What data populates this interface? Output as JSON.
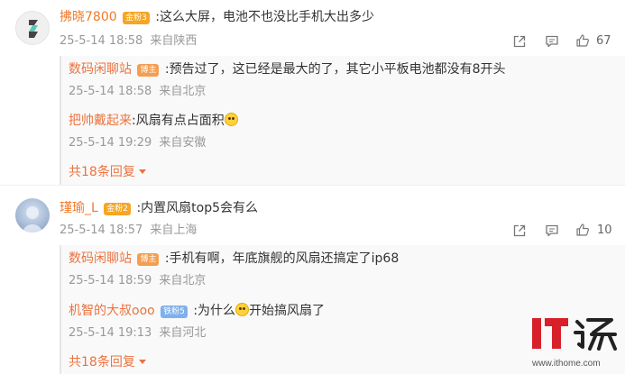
{
  "comments": [
    {
      "user": "拂晓7800",
      "badge": "金粉3",
      "text": ":这么大屏，电池不也没比手机大出多少",
      "date": "25-5-14 18:58",
      "location": "来自陕西",
      "likes": "67",
      "replies": [
        {
          "user": "数码闲聊站",
          "badge": "博主",
          "text": ":预告过了，这已经是最大的了，其它小平板电池都没有8开头",
          "date": "25-5-14 18:58",
          "location": "来自北京"
        },
        {
          "user": "把帅戴起来",
          "text": ":风扇有点占面积",
          "emoji": "laughing-crying-emoji",
          "date": "25-5-14 19:29",
          "location": "来自安徽"
        }
      ],
      "more": "共18条回复"
    },
    {
      "user": "瑾瑜_L",
      "badge": "金粉2",
      "text": ":内置风扇top5会有么",
      "date": "25-5-14 18:57",
      "location": "来自上海",
      "likes": "10",
      "replies": [
        {
          "user": "数码闲聊站",
          "badge": "博主",
          "text": ":手机有啊，年底旗舰的风扇还搞定了ip68",
          "date": "25-5-14 18:59",
          "location": "来自北京"
        },
        {
          "user": "机智的大叔ooo",
          "badge": "铁粉5",
          "text_before": ":为什么",
          "emoji": "grimace-emoji",
          "text_after": "开始搞风扇了",
          "date": "25-5-14 19:13",
          "location": "来自河北"
        }
      ],
      "more": "共18条回复"
    }
  ],
  "watermark": {
    "url": "www.ithome.com"
  },
  "colors": {
    "username": "#eb7340",
    "meta": "#999999",
    "accent": "#d8202a"
  },
  "icons": [
    "share-icon",
    "comment-icon",
    "like-icon",
    "expand-caret-icon"
  ]
}
